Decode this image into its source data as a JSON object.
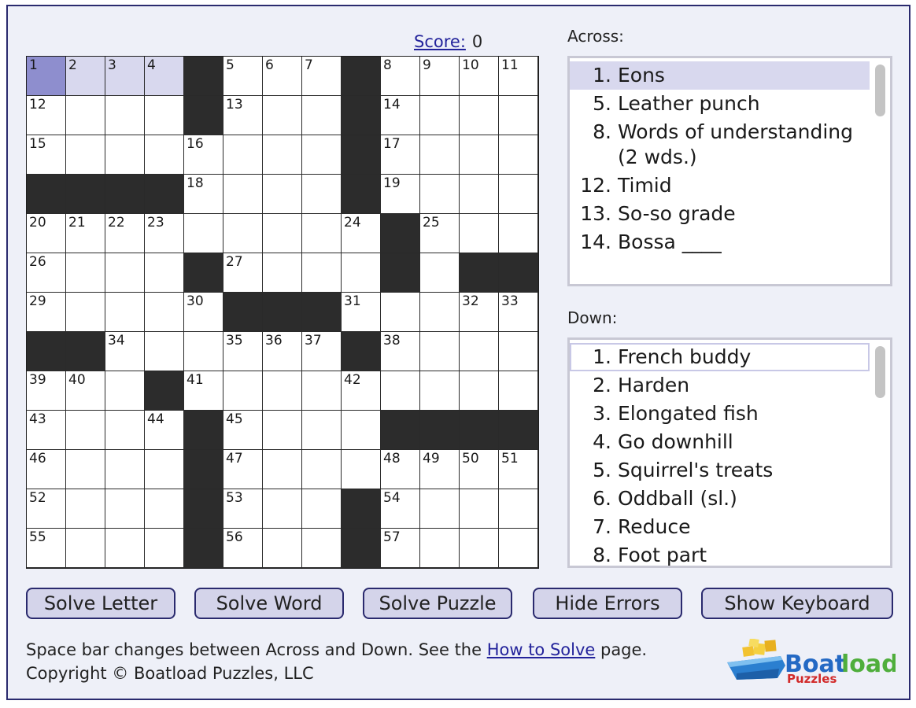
{
  "score": {
    "label": "Score:",
    "value": "0"
  },
  "grid": {
    "rows": [
      "....#...#....",
      "....#...#....",
      "........#....",
      "####....#....",
      ".........#...",
      "....#....#.##",
      ".....###.....",
      "##......#....",
      "...#.........",
      "....#....####",
      "....#........",
      "....#...#....",
      "....#...#...."
    ],
    "numbers": [
      [
        0,
        0,
        "1"
      ],
      [
        0,
        1,
        "2"
      ],
      [
        0,
        2,
        "3"
      ],
      [
        0,
        3,
        "4"
      ],
      [
        0,
        5,
        "5"
      ],
      [
        0,
        6,
        "6"
      ],
      [
        0,
        7,
        "7"
      ],
      [
        0,
        9,
        "8"
      ],
      [
        0,
        10,
        "9"
      ],
      [
        0,
        11,
        "10"
      ],
      [
        0,
        12,
        "11"
      ],
      [
        1,
        0,
        "12"
      ],
      [
        1,
        5,
        "13"
      ],
      [
        1,
        9,
        "14"
      ],
      [
        2,
        0,
        "15"
      ],
      [
        2,
        4,
        "16"
      ],
      [
        2,
        9,
        "17"
      ],
      [
        3,
        4,
        "18"
      ],
      [
        3,
        9,
        "19"
      ],
      [
        4,
        0,
        "20"
      ],
      [
        4,
        1,
        "21"
      ],
      [
        4,
        2,
        "22"
      ],
      [
        4,
        3,
        "23"
      ],
      [
        4,
        8,
        "24"
      ],
      [
        4,
        10,
        "25"
      ],
      [
        5,
        0,
        "26"
      ],
      [
        5,
        5,
        "27"
      ],
      [
        5,
        9,
        "28"
      ],
      [
        6,
        0,
        "29"
      ],
      [
        6,
        4,
        "30"
      ],
      [
        6,
        8,
        "31"
      ],
      [
        6,
        11,
        "32"
      ],
      [
        6,
        12,
        "33"
      ],
      [
        7,
        2,
        "34"
      ],
      [
        7,
        5,
        "35"
      ],
      [
        7,
        6,
        "36"
      ],
      [
        7,
        7,
        "37"
      ],
      [
        7,
        9,
        "38"
      ],
      [
        8,
        0,
        "39"
      ],
      [
        8,
        1,
        "40"
      ],
      [
        8,
        4,
        "41"
      ],
      [
        8,
        8,
        "42"
      ],
      [
        9,
        0,
        "43"
      ],
      [
        9,
        3,
        "44"
      ],
      [
        9,
        5,
        "45"
      ],
      [
        10,
        0,
        "46"
      ],
      [
        10,
        5,
        "47"
      ],
      [
        10,
        9,
        "48"
      ],
      [
        10,
        10,
        "49"
      ],
      [
        10,
        11,
        "50"
      ],
      [
        10,
        12,
        "51"
      ],
      [
        11,
        0,
        "52"
      ],
      [
        11,
        5,
        "53"
      ],
      [
        11,
        9,
        "54"
      ],
      [
        12,
        0,
        "55"
      ],
      [
        12,
        5,
        "56"
      ],
      [
        12,
        9,
        "57"
      ]
    ],
    "current_cell": [
      0,
      0
    ],
    "highlighted_word": [
      [
        0,
        1
      ],
      [
        0,
        2
      ],
      [
        0,
        3
      ]
    ]
  },
  "across": {
    "title": "Across:",
    "selected_index": 0,
    "clues": [
      {
        "num": "1.",
        "text": "Eons"
      },
      {
        "num": "5.",
        "text": "Leather punch"
      },
      {
        "num": "8.",
        "text": "Words of understanding (2 wds.)"
      },
      {
        "num": "12.",
        "text": "Timid"
      },
      {
        "num": "13.",
        "text": "So-so grade"
      },
      {
        "num": "14.",
        "text": "Bossa ____"
      }
    ]
  },
  "down": {
    "title": "Down:",
    "highlighted_index": 0,
    "clues": [
      {
        "num": "1.",
        "text": "French buddy"
      },
      {
        "num": "2.",
        "text": "Harden"
      },
      {
        "num": "3.",
        "text": "Elongated fish"
      },
      {
        "num": "4.",
        "text": "Go downhill"
      },
      {
        "num": "5.",
        "text": "Squirrel's treats"
      },
      {
        "num": "6.",
        "text": "Oddball (sl.)"
      },
      {
        "num": "7.",
        "text": "Reduce"
      },
      {
        "num": "8.",
        "text": "Foot part"
      }
    ]
  },
  "buttons": {
    "solve_letter": "Solve Letter",
    "solve_word": "Solve Word",
    "solve_puzzle": "Solve Puzzle",
    "hide_errors": "Hide Errors",
    "show_keyboard": "Show Keyboard"
  },
  "footer": {
    "line1_prefix": "Space bar changes between Across and Down. See the ",
    "link": "How to Solve",
    "line1_suffix": " page.",
    "copyright": "Copyright © Boatload Puzzles, LLC"
  },
  "logo": {
    "word1": "Boat",
    "word2": "load",
    "sub": "Puzzles"
  },
  "colors": {
    "frame_border": "#2a2a6e",
    "background": "#eef0f8",
    "current_cell": "#8e8ece",
    "highlight": "#d8d8ee",
    "block": "#2c2c2c",
    "link": "#23239b"
  }
}
